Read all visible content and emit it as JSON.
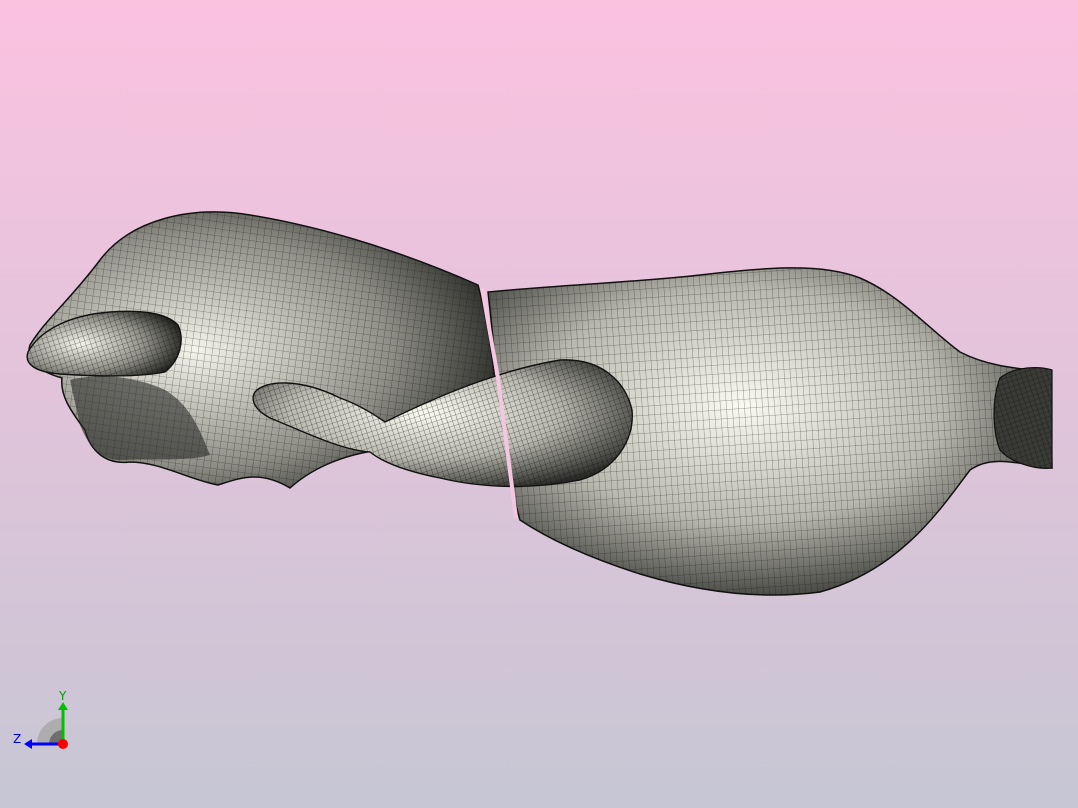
{
  "viewer": {
    "background_top": "#fbc2e0",
    "background_bottom": "#c6c6d4",
    "mesh_fill": "#e6e6dc",
    "mesh_line": "#1a1a1a"
  },
  "axis_triad": {
    "y_label": "Y",
    "z_label": "Z",
    "x_axis_color": "#ff0000",
    "y_axis_color": "#00c000",
    "z_axis_color": "#0000ff"
  }
}
